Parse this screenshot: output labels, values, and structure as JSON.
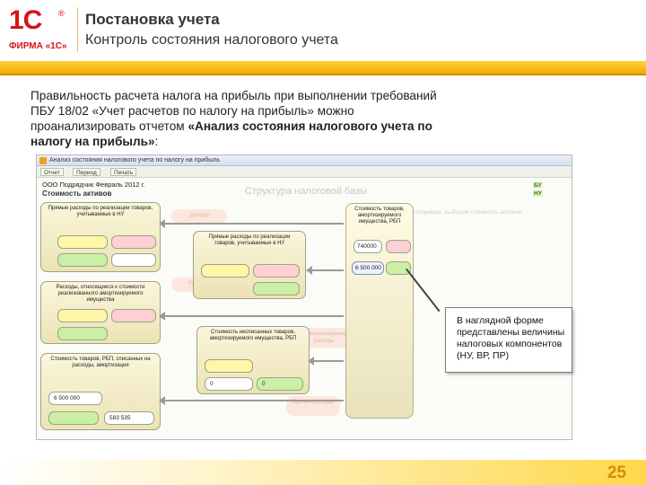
{
  "header": {
    "logo_mark": "1С",
    "logo_reg": "®",
    "logo_firm": "ФИРМА «1С»",
    "title": "Постановка учета",
    "subtitle": "Контроль состояния налогового учета"
  },
  "intro": {
    "text_plain": "Правильность расчета налога на прибыль при выполнении требований ПБУ 18/02 «Учет расчетов по налогу на прибыль» можно проанализировать отчетом ",
    "text_bold": "«Анализ состояния налогового учета по налогу на прибыль»",
    "text_end": ":"
  },
  "screenshot": {
    "window_title": "Анализ состояния налогового учета по налогу на прибыль",
    "toolbar": [
      "Отчет",
      "Период",
      "Печать"
    ],
    "period": "ООО Подрядчик Февраль 2012 г.",
    "heading": "Стоимость активов",
    "big_title": "Структура налоговой базы",
    "legend": [
      "БУ",
      "НУ"
    ],
    "groups": [
      {
        "label": "Прямые расходы по реализации товаров, учитываемые в НУ"
      },
      {
        "label": "Прямые расходы по реализации товаров, учитываемые в НУ"
      },
      {
        "label": "Расходы, относящиеся к стоимости реализованного амортизируемого имущества"
      },
      {
        "label": "Стоимость несписанных товаров, амортизируемого имущества, РБП"
      },
      {
        "label": "Стоимость товаров, РБП, списанных на расходы, амортизация"
      }
    ],
    "big_group": {
      "label": "Стоимость товаров, амортизируемого имущества, РБП",
      "value1": "740000",
      "value2": "6 500 000"
    },
    "values": [
      "6 500 000",
      "583 535",
      "0",
      "0"
    ],
    "ghost_labels": [
      "Доходы",
      "Расходы",
      "Внереализационные расходы",
      "Прочие расходы",
      "Например, выберем стоимость активов"
    ]
  },
  "callout": {
    "text": "В наглядной форме представлены величины налоговых компонентов (НУ, ВР, ПР)"
  },
  "footer": {
    "page_number": "25"
  }
}
